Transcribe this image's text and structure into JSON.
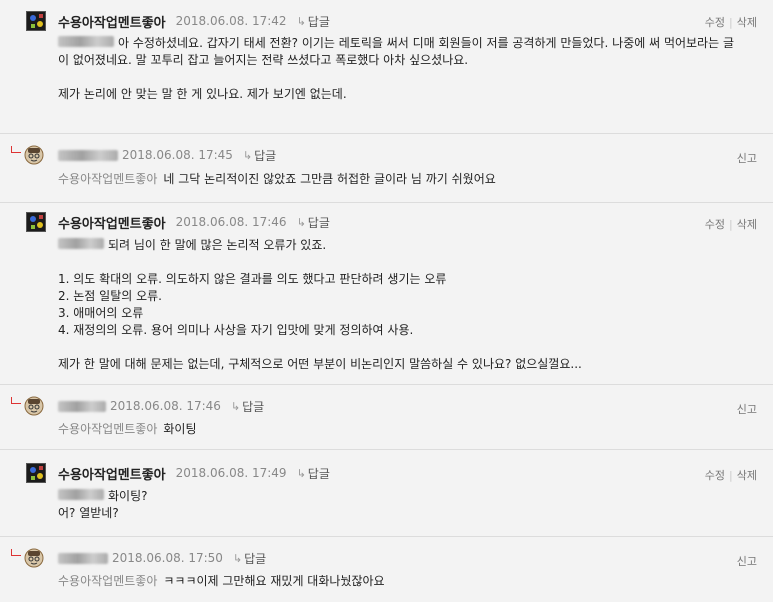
{
  "actions": {
    "edit": "수정",
    "separator": "|",
    "delete": "삭제",
    "report": "신고"
  },
  "reply_label": "답글",
  "reply_icon": "↳",
  "comments": [
    {
      "author": "수용아작업멘트좋아",
      "date": "2018.06.08. 17:42",
      "lines": [
        "아 수정하셨네요. 갑자기 태세 전환? 이기는 레토릭을 써서 디매 회원들이 저를 공격하게 만들었다. 나중에 써 먹어보라는 글",
        "이 없어졌네요. 말 꼬투리 잡고 늘어지는 전략 쓰셨다고 폭로했다 아차 싶으셨나요.",
        "제가 논리에 안 맞는 말 한 게 있나요. 제가 보기엔 없는데."
      ]
    },
    {
      "date": "2018.06.08. 17:45",
      "mention": "수용아작업멘트좋아",
      "text": "네 그닥 논리적이진 않았죠 그만큼 허접한 글이라 님 까기 쉬웠어요"
    },
    {
      "author": "수용아작업멘트좋아",
      "date": "2018.06.08. 17:46",
      "lines": [
        "되려 님이 한 말에 많은 논리적 오류가 있죠.",
        "1. 의도 확대의 오류. 의도하지 않은 결과를 의도 했다고 판단하려 생기는 오류",
        "2. 논점 일탈의 오류.",
        "3. 애매어의 오류",
        "4. 재정의의 오류. 용어 의미나 사상을 자기 입맛에 맞게 정의하여 사용.",
        "제가 한 말에 대해 문제는 없는데, 구체적으로 어떤 부분이 비논리인지 말씀하실 수 있나요? 없으실껄요..."
      ]
    },
    {
      "date": "2018.06.08. 17:46",
      "mention": "수용아작업멘트좋아",
      "text": "화이팅"
    },
    {
      "author": "수용아작업멘트좋아",
      "date": "2018.06.08. 17:49",
      "lines": [
        "화이팅?",
        "어? 열받네?"
      ]
    },
    {
      "date": "2018.06.08. 17:50",
      "mention": "수용아작업멘트좋아",
      "text": "ㅋㅋㅋ이제 그만해요 재밌게 대화나눴잖아요"
    }
  ]
}
